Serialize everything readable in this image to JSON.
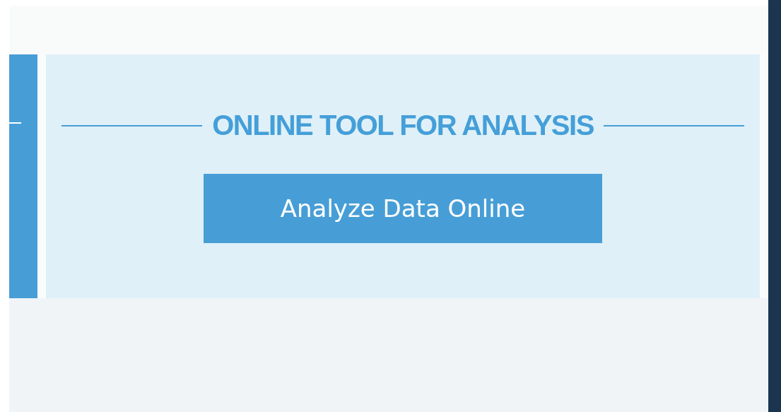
{
  "heading": "ONLINE TOOL FOR ANALYSIS",
  "button": "Analyze Data Online"
}
